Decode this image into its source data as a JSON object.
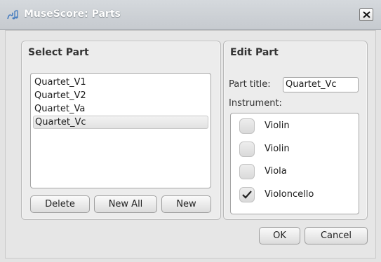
{
  "window": {
    "title": "MuseScore: Parts"
  },
  "select_part": {
    "heading": "Select Part",
    "parts": [
      {
        "label": "Quartet_V1",
        "selected": false
      },
      {
        "label": "Quartet_V2",
        "selected": false
      },
      {
        "label": "Quartet_Va",
        "selected": false
      },
      {
        "label": "Quartet_Vc",
        "selected": true
      }
    ],
    "buttons": {
      "delete": "Delete",
      "new_all": "New All",
      "new": "New"
    }
  },
  "edit_part": {
    "heading": "Edit Part",
    "part_title_label": "Part title:",
    "part_title_value": "Quartet_Vc",
    "instrument_label": "Instrument:",
    "instruments": [
      {
        "label": "Violin",
        "checked": false
      },
      {
        "label": "Violin",
        "checked": false
      },
      {
        "label": "Viola",
        "checked": false
      },
      {
        "label": "Violoncello",
        "checked": true
      }
    ]
  },
  "footer": {
    "ok_label": "OK",
    "cancel_label": "Cancel"
  }
}
